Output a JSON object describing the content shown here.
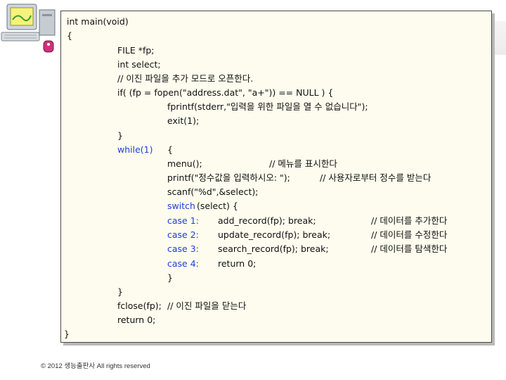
{
  "code": {
    "line01": "int main(void)",
    "line02": "{",
    "line03": "FILE *fp;",
    "line04": "int select;",
    "line05": "// 이진 파일을 추가 모드로 오픈한다.",
    "line06": "if( (fp = fopen(\"address.dat\", \"a+\")) == NULL ) {",
    "line07": "fprintf(stderr,\"입력을 위한 파일을 열 수 없습니다\");",
    "line08": "exit(1);",
    "line09": "}",
    "line10_kw": "while(1)",
    "line10_rest": "{",
    "line11_a": "menu();",
    "line11_b": "// 메뉴를 표시한다",
    "line12_a": "printf(\"정수값을 입력하시오: \");",
    "line12_b": "// 사용자로부터 정수를 받는다",
    "line13": "scanf(\"%d\",&select);",
    "line14_kw": "switch",
    "line14_rest": "(select) {",
    "case1_label": "case 1:",
    "case1_stmt": "add_record(fp); break;",
    "case1_comment": "// 데이터를 추가한다",
    "case2_label": "case 2:",
    "case2_stmt": "update_record(fp); break;",
    "case2_comment": "// 데이터를 수정한다",
    "case3_label": "case 3:",
    "case3_stmt": "search_record(fp); break;",
    "case3_comment": "// 데이터를 탐색한다",
    "case4_label": "case 4:",
    "case4_stmt": "return 0;",
    "line19": "}",
    "line20": "}",
    "line21_a": "fclose(fp);",
    "line21_b": "// 이진 파일을 닫는다",
    "line22": "return 0;",
    "line23": "}"
  },
  "footer": "© 2012 생능출판사 All rights reserved"
}
